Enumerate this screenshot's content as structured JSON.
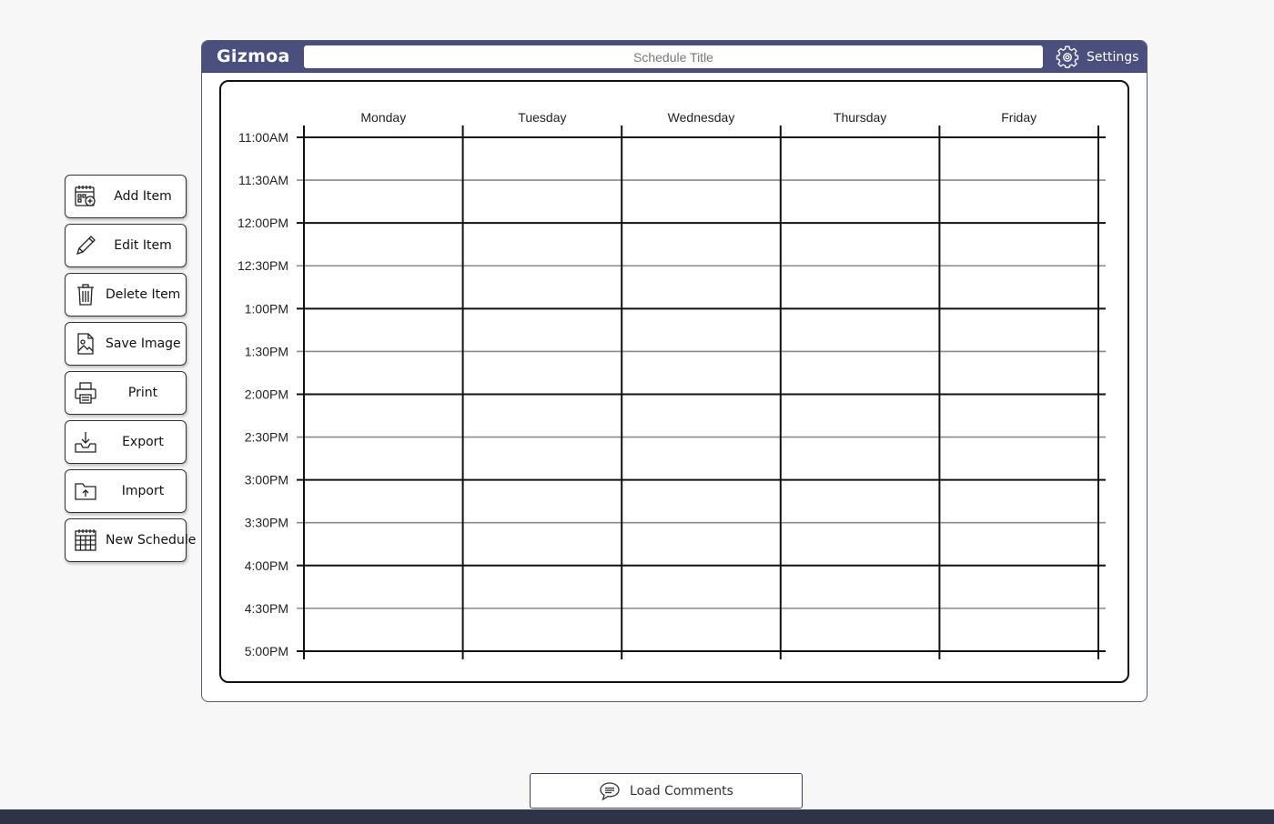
{
  "app": {
    "logo": "Gizmoa",
    "title_placeholder": "Schedule Title",
    "settings_label": "Settings"
  },
  "actions": [
    {
      "label": "Add Item",
      "icon": "calendar-add-icon"
    },
    {
      "label": "Edit Item",
      "icon": "pencil-icon"
    },
    {
      "label": "Delete Item",
      "icon": "trash-icon"
    },
    {
      "label": "Save Image",
      "icon": "image-file-icon"
    },
    {
      "label": "Print",
      "icon": "printer-icon"
    },
    {
      "label": "Export",
      "icon": "tray-download-icon"
    },
    {
      "label": "Import",
      "icon": "folder-upload-icon"
    },
    {
      "label": "New Schedule",
      "icon": "calendar-grid-icon"
    }
  ],
  "schedule": {
    "days": [
      "Monday",
      "Tuesday",
      "Wednesday",
      "Thursday",
      "Friday"
    ],
    "times": [
      "11:00AM",
      "11:30AM",
      "12:00PM",
      "12:30PM",
      "1:00PM",
      "1:30PM",
      "2:00PM",
      "2:30PM",
      "3:00PM",
      "3:30PM",
      "4:00PM",
      "4:30PM",
      "5:00PM"
    ]
  },
  "comments": {
    "label": "Load Comments"
  },
  "colors": {
    "brand_bar": "#4a4f7e",
    "footer": "#2e3447",
    "hour_line": "#111111",
    "half_hour_line": "#8a8a8a"
  }
}
